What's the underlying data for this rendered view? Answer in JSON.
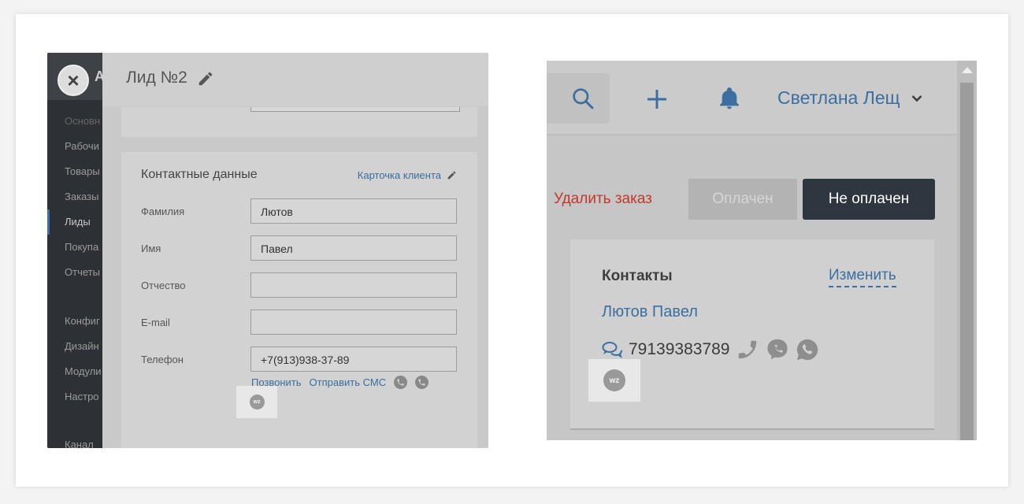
{
  "left": {
    "sidebar": {
      "letter": "A",
      "items": [
        {
          "label": "Основн",
          "dim": true
        },
        {
          "label": "Рабочи",
          "dim": false
        },
        {
          "label": "Товары",
          "dim": false
        },
        {
          "label": "Заказы",
          "dim": false
        },
        {
          "label": "Лиды",
          "dim": false
        },
        {
          "label": "Покупа",
          "dim": false
        },
        {
          "label": "Отчеты",
          "dim": false
        },
        {
          "label": "Конфиг",
          "dim": false
        },
        {
          "label": "Дизайн",
          "dim": false
        },
        {
          "label": "Модули",
          "dim": false
        },
        {
          "label": "Настро",
          "dim": false
        },
        {
          "label": "Канал",
          "dim": false
        }
      ]
    },
    "lead": {
      "title": "Лид №2",
      "section_title": "Контактные данные",
      "client_card_link": "Карточка клиента",
      "fields": [
        {
          "label": "Фамилия",
          "value": "Лютов"
        },
        {
          "label": "Имя",
          "value": "Павел"
        },
        {
          "label": "Отчество",
          "value": ""
        },
        {
          "label": "E-mail",
          "value": ""
        },
        {
          "label": "Телефон",
          "value": "+7(913)938-37-89"
        }
      ],
      "call_link": "Позвонить",
      "sms_link": "Отправить СМС"
    },
    "wz_logo": "wz"
  },
  "right": {
    "user_name": "Светлана Лещ",
    "delete_order": "Удалить заказ",
    "btn_paid": "Оплачен",
    "btn_unpaid": "Не оплачен",
    "contacts": {
      "title": "Контакты",
      "edit_link": "Изменить",
      "name": "Лютов Павел",
      "phone": "79139383789"
    },
    "wz_logo": "wz"
  },
  "colors": {
    "link": "#3c6f9f",
    "danger": "#c0392b",
    "dark_button": "#2e3640"
  }
}
